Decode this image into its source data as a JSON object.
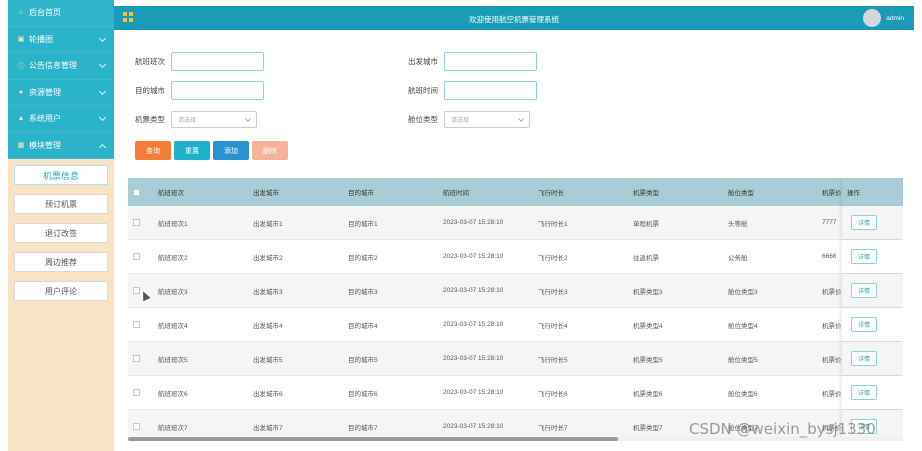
{
  "sidebar": {
    "items": [
      {
        "label": "后台首页",
        "icon": "home-icon",
        "glyph": "⌂"
      },
      {
        "label": "轮播图",
        "icon": "picture-icon",
        "glyph": "▣"
      },
      {
        "label": "公告信息管理",
        "icon": "info-icon",
        "glyph": "ⓘ"
      },
      {
        "label": "资源管理",
        "icon": "pin-icon",
        "glyph": "●"
      },
      {
        "label": "系统用户",
        "icon": "user-icon",
        "glyph": "▲"
      },
      {
        "label": "模块管理",
        "icon": "module-icon",
        "glyph": "▦"
      }
    ],
    "subitems": [
      "机票信息",
      "预订机票",
      "退订改签",
      "周边推荐",
      "用户评论"
    ]
  },
  "header": {
    "title": "欢迎使用航空机票管理系统",
    "user": "admin"
  },
  "form": {
    "flight_no": "航班班次",
    "dep_city": "出发城市",
    "dest_city": "目的城市",
    "flight_time": "航班时间",
    "ticket_type": "机票类型",
    "cabin_type": "舱位类型",
    "select_placeholder": "请选择"
  },
  "buttons": {
    "query": "查询",
    "reset": "重置",
    "add": "添加",
    "delete": "删除"
  },
  "table": {
    "headers": [
      "航班班次",
      "出发城市",
      "目的城市",
      "航班时间",
      "飞行时长",
      "机票类型",
      "舱位类型",
      "机票价",
      "操作"
    ],
    "detail_label": "详情",
    "rows": [
      [
        "航班班次1",
        "出发城市1",
        "目的城市1",
        "2023-03-07 15:28:10",
        "飞行时长1",
        "单程机票",
        "头等舱",
        "7777"
      ],
      [
        "航班班次2",
        "出发城市2",
        "目的城市2",
        "2023-03-07 15:28:10",
        "飞行时长2",
        "往返机票",
        "公务舱",
        "6666"
      ],
      [
        "航班班次3",
        "出发城市3",
        "目的城市3",
        "2023-03-07 15:28:10",
        "飞行时长3",
        "机票类型3",
        "舱位类型3",
        "机票价"
      ],
      [
        "航班班次4",
        "出发城市4",
        "目的城市4",
        "2023-03-07 15:28:10",
        "飞行时长4",
        "机票类型4",
        "舱位类型4",
        "机票价"
      ],
      [
        "航班班次5",
        "出发城市5",
        "目的城市5",
        "2023-03-07 15:28:10",
        "飞行时长5",
        "机票类型5",
        "舱位类型5",
        "机票价"
      ],
      [
        "航班班次6",
        "出发城市6",
        "目的城市6",
        "2023-03-07 15:28:10",
        "飞行时长6",
        "机票类型6",
        "舱位类型6",
        "机票价"
      ],
      [
        "航班班次7",
        "出发城市7",
        "目的城市7",
        "2023-03-07 15:28:10",
        "飞行时长7",
        "机票类型7",
        "舱位类型7",
        "机票价"
      ]
    ]
  },
  "watermark": "CSDN @weixin_bysj1330",
  "colors": {
    "accent": "#1a9cb8",
    "sidebar_bg": "#f8e3c5",
    "query": "#f47c36",
    "reset": "#1eb1cb",
    "add": "#2a92cf",
    "delete": "#f6b39a"
  }
}
